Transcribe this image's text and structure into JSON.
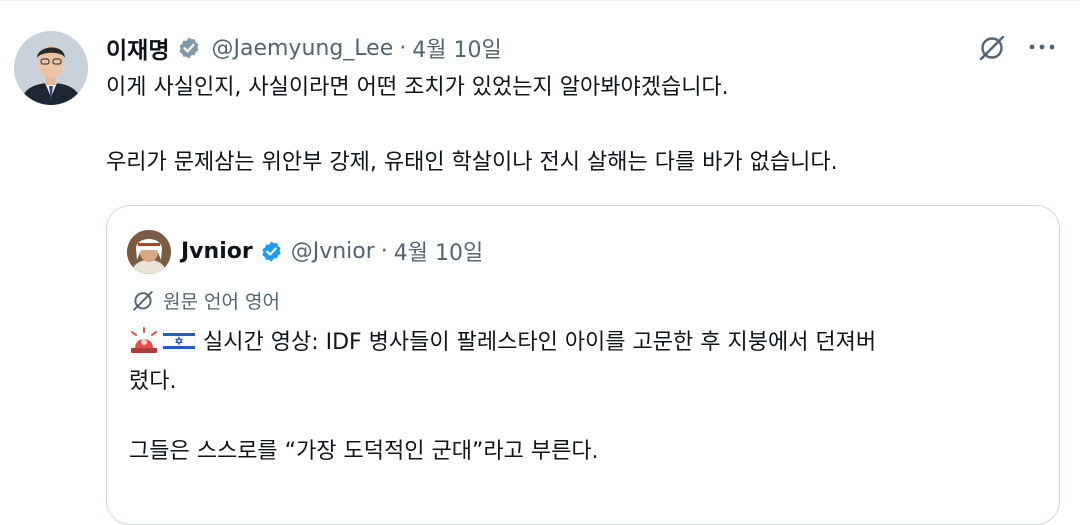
{
  "tweet": {
    "display_name": "이재명",
    "handle": "@Jaemyung_Lee",
    "separator": "·",
    "date": "4월 10일",
    "lines": [
      "이게 사실인지, 사실이라면 어떤 조치가 있었는지 알아봐야겠습니다.",
      "우리가 문제삼는 위안부 강제, 유태인 학살이나 전시 살해는 다를 바가 없습니다."
    ]
  },
  "quoted": {
    "display_name": "Jvnior",
    "handle": "@Jvnior",
    "separator": "·",
    "date": "4월 10일",
    "translate_label": "원문 언어 영어",
    "line1": "실시간 영상: IDF 병사들이 팔레스타인 아이를 고문한 후 지붕에서 던져버",
    "line2": "렸다.",
    "line3": "그들은 스스로를 “가장 도덕적인 군대”라고 부른다."
  },
  "icons": {
    "verified": "verified-badge-icon",
    "grok": "grok-icon",
    "more": "more-icon",
    "translate": "translate-icon",
    "siren": "siren-emoji",
    "flag": "israel-flag-emoji"
  },
  "colors": {
    "text": "#0f1419",
    "secondary": "#536471",
    "verified_blue": "#1d9bf0",
    "verified_gray": "#829aab",
    "border": "#cfd9de"
  }
}
